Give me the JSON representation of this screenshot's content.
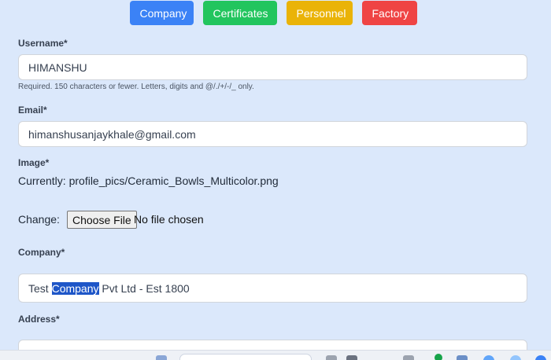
{
  "tabs": [
    {
      "label": "Company",
      "color": "#3b82f6"
    },
    {
      "label": "Certificates",
      "color": "#22c55e"
    },
    {
      "label": "Personnel",
      "color": "#eab308"
    },
    {
      "label": "Factory",
      "color": "#ef4444"
    }
  ],
  "form": {
    "username": {
      "label": "Username*",
      "value": "HIMANSHU",
      "help": "Required. 150 characters or fewer. Letters, digits and @/./+/-/_ only."
    },
    "email": {
      "label": "Email*",
      "value": "himanshusanjaykhale@gmail.com"
    },
    "image": {
      "label": "Image*",
      "currently_label": "Currently:",
      "currently_value": "profile_pics/Ceramic_Bowls_Multicolor.png",
      "change_label": "Change:",
      "choose_file_button": "Choose File",
      "no_file_text": "No file chosen"
    },
    "company": {
      "label": "Company*",
      "value_prefix": "Test ",
      "value_selected": "Company",
      "value_suffix": " Pvt Ltd - Est 1800"
    },
    "address": {
      "label": "Address*",
      "value": ""
    }
  },
  "colors": {
    "page_background": "#dbe8fb",
    "selection": "#1e56c8"
  }
}
